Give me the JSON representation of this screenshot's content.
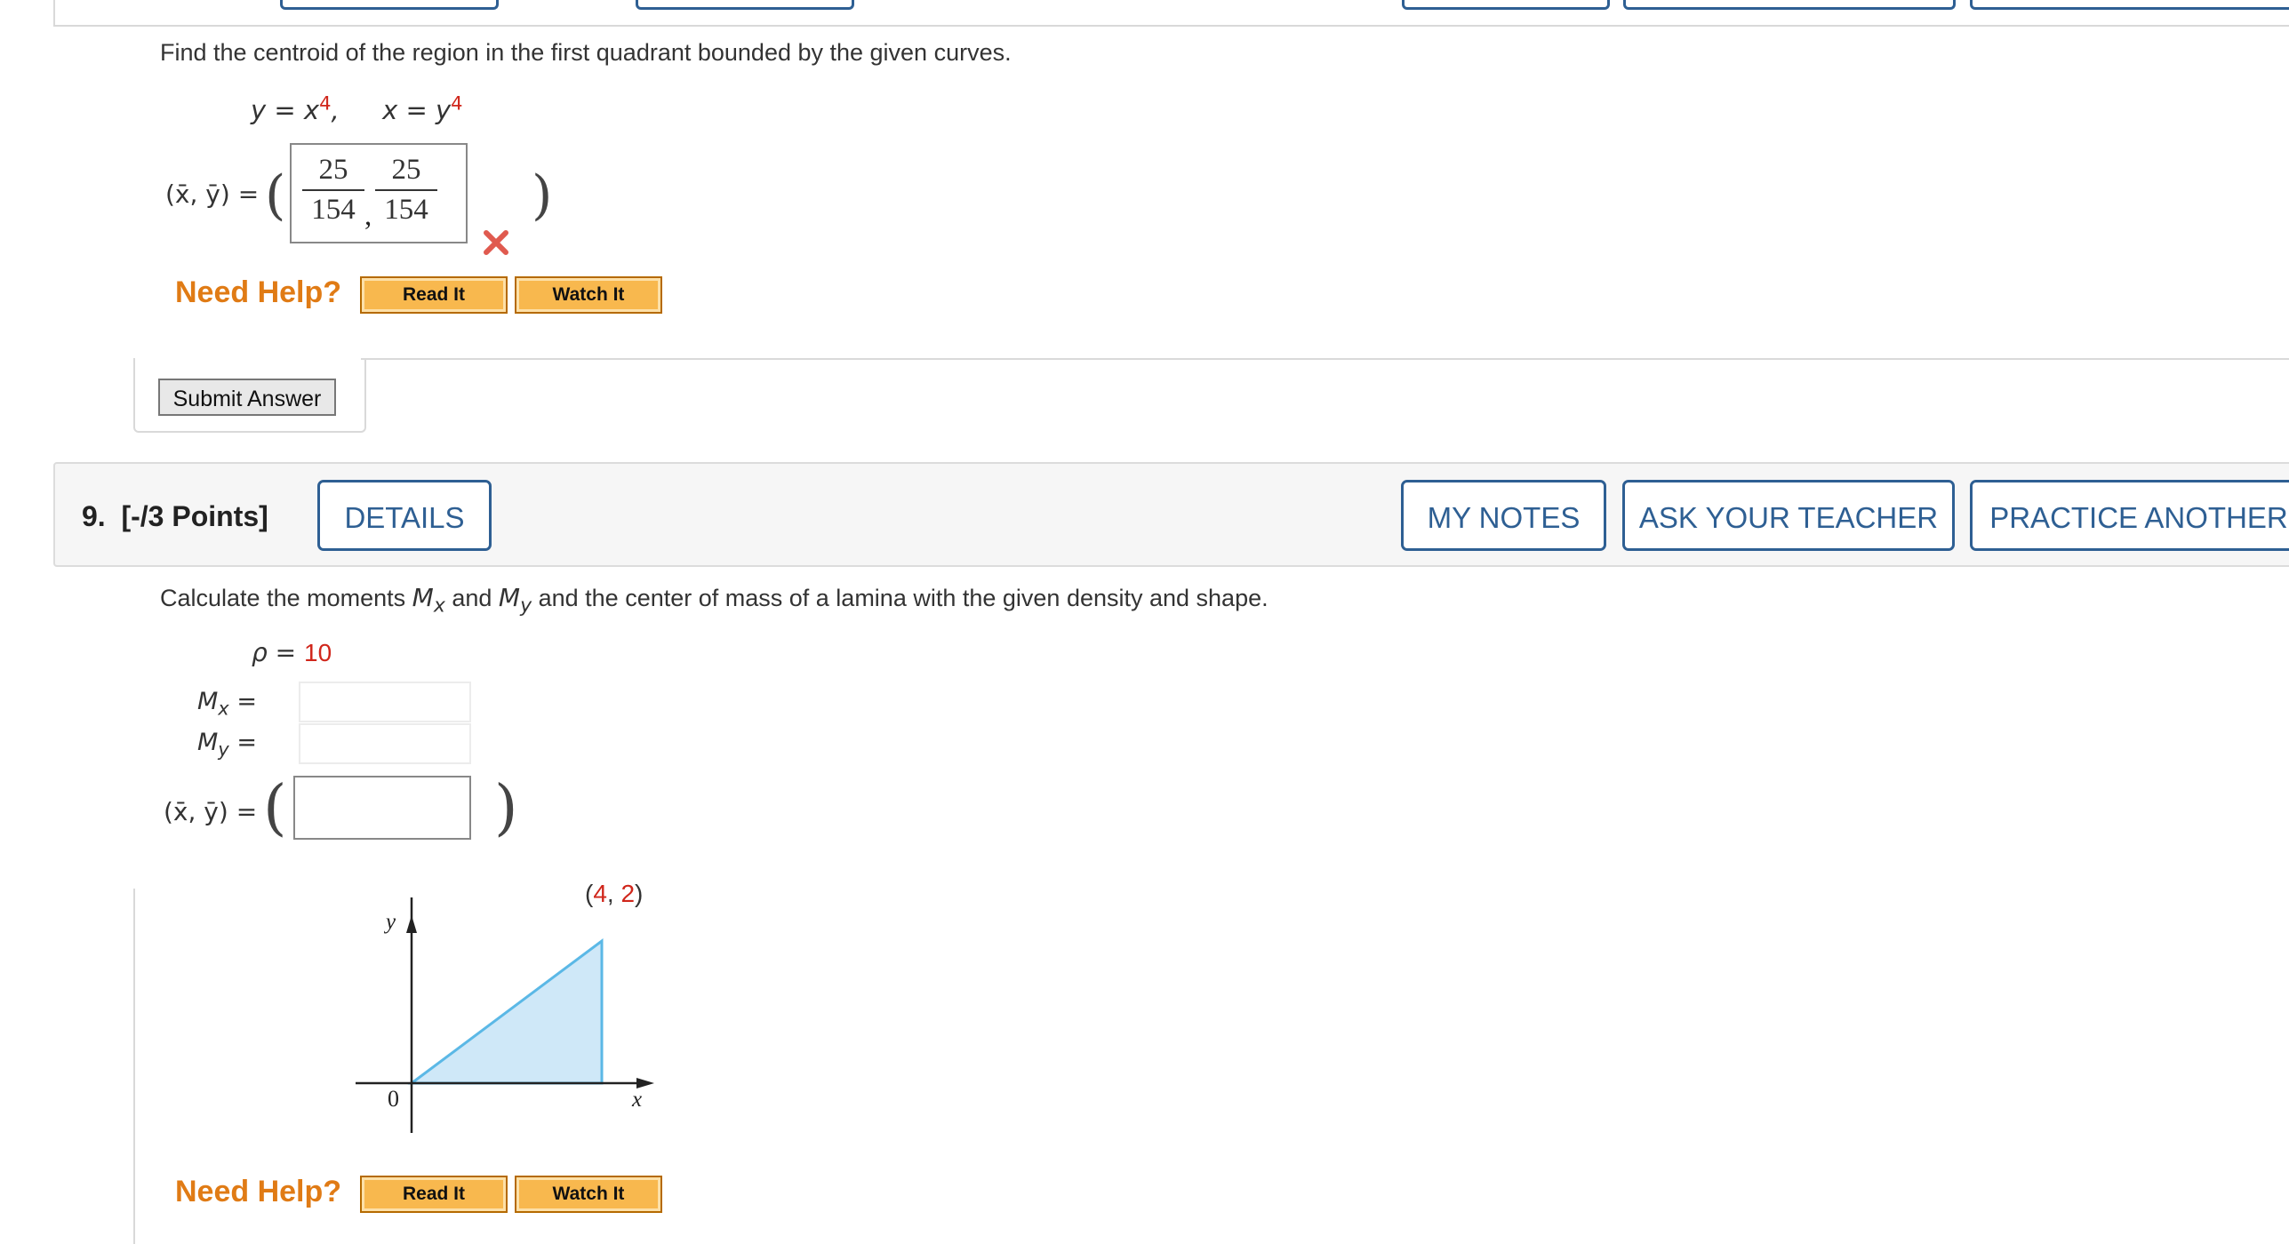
{
  "prev_question": {
    "prompt": "Find the centroid of the region in the first quadrant bounded by the given curves.",
    "curve1_lhs": "y = x",
    "curve1_exp": "4",
    "curve2_lhs": "x = y",
    "curve2_exp": "4",
    "centroid_label": "(x̄, ȳ) =",
    "answer": {
      "x_num": "25",
      "x_den": "154",
      "y_num": "25",
      "y_den": "154"
    },
    "result": "incorrect",
    "need_help": "Need Help?",
    "read_it": "Read It",
    "watch_it": "Watch It",
    "submit": "Submit Answer"
  },
  "question": {
    "number": "9.",
    "points": "[-/3 Points]",
    "details": "DETAILS",
    "my_notes": "MY NOTES",
    "ask_teacher": "ASK YOUR TEACHER",
    "practice_another": "PRACTICE ANOTHER",
    "prompt_a": "Calculate the moments ",
    "mx_sym": "M",
    "mx_sub": "x",
    "prompt_b": " and ",
    "my_sym": "M",
    "my_sub": "y",
    "prompt_c": " and the center of mass of a lamina with the given density and shape.",
    "rho_label": "ρ = ",
    "rho_value": "10",
    "mx_label": "M",
    "mx_label_sub": "x",
    "my_label": "M",
    "my_label_sub": "y",
    "eq": "=",
    "centroid_label": "(x̄, ȳ) =",
    "mx_value": "",
    "my_value": "",
    "center_value": "",
    "graph": {
      "point_open": "(",
      "point_x": "4",
      "point_comma": ", ",
      "point_y": "2",
      "point_close": ")",
      "x_axis": "x",
      "y_axis": "y",
      "origin": "0",
      "fill": "#cfe8f8",
      "stroke": "#5bb8e6"
    },
    "need_help": "Need Help?",
    "read_it": "Read It",
    "watch_it": "Watch It"
  },
  "colors": {
    "accent": "#2e5f93",
    "help": "#e07b15",
    "error": "#d0261b"
  }
}
